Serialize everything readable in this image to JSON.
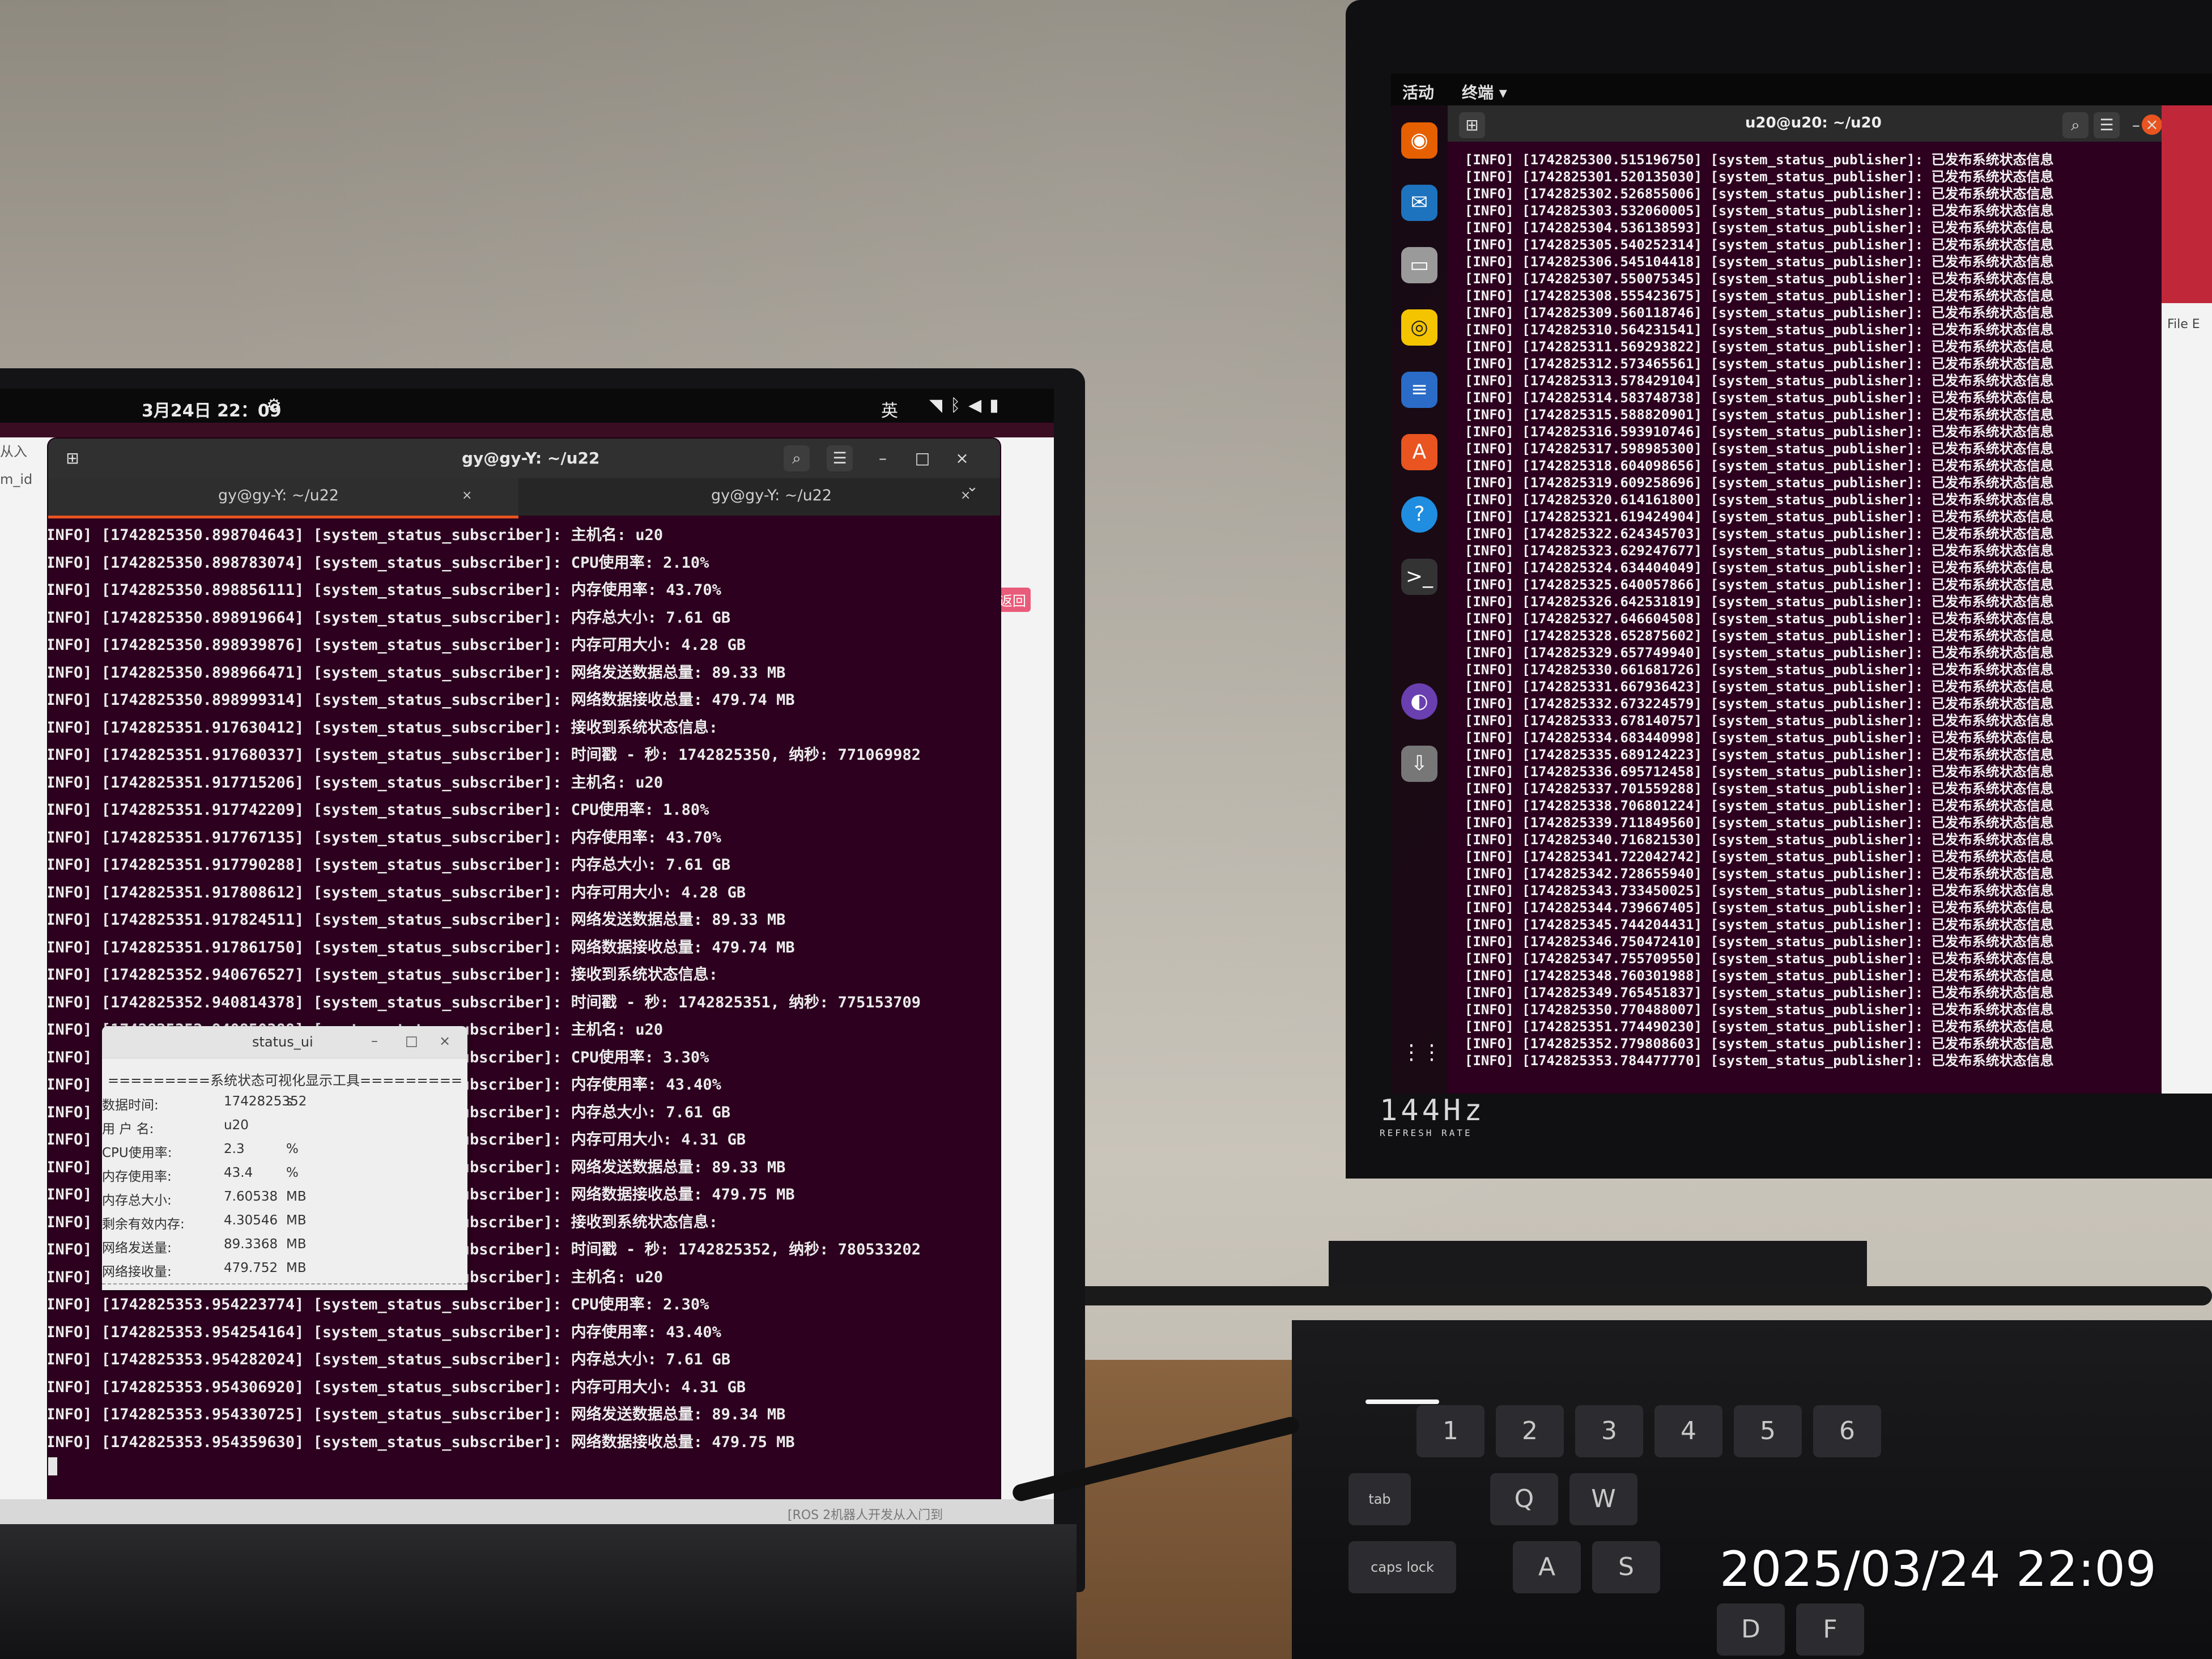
{
  "laptop": {
    "topbar": {
      "clock": "3月24日 22：09",
      "ime": "英"
    },
    "background_window": {
      "left_text_1": "从入",
      "left_text_2": "m_id",
      "badge": "返回"
    },
    "terminal": {
      "title": "gy@gy-Y: ~/u22",
      "tabs": [
        {
          "label": "gy@gy-Y: ~/u22"
        },
        {
          "label": "gy@gy-Y: ~/u22"
        }
      ],
      "lines": [
        "[INFO] [1742825350.898704643] [system_status_subscriber]: 主机名: u20",
        "[INFO] [1742825350.898783074] [system_status_subscriber]: CPU使用率: 2.10%",
        "[INFO] [1742825350.898856111] [system_status_subscriber]: 内存使用率: 43.70%",
        "[INFO] [1742825350.898919664] [system_status_subscriber]: 内存总大小: 7.61 GB",
        "[INFO] [1742825350.898939876] [system_status_subscriber]: 内存可用大小: 4.28 GB",
        "[INFO] [1742825350.898966471] [system_status_subscriber]: 网络发送数据总量: 89.33 MB",
        "[INFO] [1742825350.898999314] [system_status_subscriber]: 网络数据接收总量: 479.74 MB",
        "[INFO] [1742825351.917630412] [system_status_subscriber]: 接收到系统状态信息:",
        "[INFO] [1742825351.917680337] [system_status_subscriber]: 时间戳 - 秒: 1742825350, 纳秒: 771069982",
        "[INFO] [1742825351.917715206] [system_status_subscriber]: 主机名: u20",
        "[INFO] [1742825351.917742209] [system_status_subscriber]: CPU使用率: 1.80%",
        "[INFO] [1742825351.917767135] [system_status_subscriber]: 内存使用率: 43.70%",
        "[INFO] [1742825351.917790288] [system_status_subscriber]: 内存总大小: 7.61 GB",
        "[INFO] [1742825351.917808612] [system_status_subscriber]: 内存可用大小: 4.28 GB",
        "[INFO] [1742825351.917824511] [system_status_subscriber]: 网络发送数据总量: 89.33 MB",
        "[INFO] [1742825351.917861750] [system_status_subscriber]: 网络数据接收总量: 479.74 MB",
        "[INFO] [1742825352.940676527] [system_status_subscriber]: 接收到系统状态信息:",
        "[INFO] [1742825352.940814378] [system_status_subscriber]: 时间戳 - 秒: 1742825351, 纳秒: 775153709",
        "[INFO] [1742825352.940850388] [system_status_subscriber]: 主机名: u20",
        "[INFO] [1742825352.940888817] [system_status_subscriber]: CPU使用率: 3.30%",
        "[INFO] [1742825352.940924936] [system_status_subscriber]: 内存使用率: 43.40%",
        "[INFO] [1742825352.940958902] [system_status_subscriber]: 内存总大小: 7.61 GB",
        "[INFO] [1742825352.940989244] [system_status_subscriber]: 内存可用大小: 4.31 GB",
        "[INFO] [1742825352.941022103] [system_status_subscriber]: 网络发送数据总量: 89.33 MB",
        "[INFO] [1742825352.941057308] [system_status_subscriber]: 网络数据接收总量: 479.75 MB",
        "[INFO] [1742825353.954055702] [system_status_subscriber]: 接收到系统状态信息:",
        "[INFO] [1742825353.954167562] [system_status_subscriber]: 时间戳 - 秒: 1742825352, 纳秒: 780533202",
        "[INFO] [1742825353.954198097] [system_status_subscriber]: 主机名: u20",
        "[INFO] [1742825353.954223774] [system_status_subscriber]: CPU使用率: 2.30%",
        "[INFO] [1742825353.954254164] [system_status_subscriber]: 内存使用率: 43.40%",
        "[INFO] [1742825353.954282024] [system_status_subscriber]: 内存总大小: 7.61 GB",
        "[INFO] [1742825353.954306920] [system_status_subscriber]: 内存可用大小: 4.31 GB",
        "[INFO] [1742825353.954330725] [system_status_subscriber]: 网络发送数据总量: 89.34 MB",
        "[INFO] [1742825353.954359630] [system_status_subscriber]: 网络数据接收总量: 479.75 MB"
      ]
    },
    "status_window": {
      "title": "status_ui",
      "heading": "=========系统状态可视化显示工具=========",
      "rows": [
        {
          "label": "数据时间:",
          "value": "1742825352",
          "unit": "s"
        },
        {
          "label": "用 户 名:",
          "value": "u20",
          "unit": ""
        },
        {
          "label": "CPU使用率:",
          "value": "2.3",
          "unit": "%"
        },
        {
          "label": "内存使用率:",
          "value": "43.4",
          "unit": "%"
        },
        {
          "label": "内存总大小:",
          "value": "7.60538",
          "unit": "MB"
        },
        {
          "label": "剩余有效内存:",
          "value": "4.30546",
          "unit": "MB"
        },
        {
          "label": "网络发送量:",
          "value": "89.3368",
          "unit": "MB"
        },
        {
          "label": "网络接收量:",
          "value": "479.752",
          "unit": "MB"
        }
      ]
    },
    "bottom_strip": "[ROS 2机器人开发从入门到"
  },
  "monitor": {
    "topbar": {
      "activities": "活动",
      "app_menu": "终端 ▾"
    },
    "terminal_title": "u20@u20: ~/u20",
    "side_window_text": "File E",
    "log_prefix": "[INFO] [",
    "log_suffix": "] [system_status_publisher]: 已发布系统状态信息",
    "timestamps": [
      "1742825300.515196750",
      "1742825301.520135030",
      "1742825302.526855006",
      "1742825303.532060005",
      "1742825304.536138593",
      "1742825305.540252314",
      "1742825306.545104418",
      "1742825307.550075345",
      "1742825308.555423675",
      "1742825309.560118746",
      "1742825310.564231541",
      "1742825311.569293822",
      "1742825312.573465561",
      "1742825313.578429104",
      "1742825314.583748738",
      "1742825315.588820901",
      "1742825316.593910746",
      "1742825317.598985300",
      "1742825318.604098656",
      "1742825319.609258696",
      "1742825320.614161800",
      "1742825321.619424904",
      "1742825322.624345703",
      "1742825323.629247677",
      "1742825324.634404049",
      "1742825325.640057866",
      "1742825326.642531819",
      "1742825327.646604508",
      "1742825328.652875602",
      "1742825329.657749940",
      "1742825330.661681726",
      "1742825331.667936423",
      "1742825332.673224579",
      "1742825333.678140757",
      "1742825334.683440998",
      "1742825335.689124223",
      "1742825336.695712458",
      "1742825337.701559288",
      "1742825338.706801224",
      "1742825339.711849560",
      "1742825340.716821530",
      "1742825341.722042742",
      "1742825342.728655940",
      "1742825343.733450025",
      "1742825344.739667405",
      "1742825345.744204431",
      "1742825346.750472410",
      "1742825347.755709550",
      "1742825348.760301988",
      "1742825349.765451837",
      "1742825350.770488007",
      "1742825351.774490230",
      "1742825352.779808603",
      "1742825353.784477770"
    ],
    "refresh_hz": "144Hz",
    "refresh_rate": "REFRESH RATE"
  },
  "keyboard": {
    "keys": [
      "1",
      "2",
      "3",
      "4",
      "5",
      "6",
      "Q",
      "W",
      "A",
      "S",
      "D",
      "F",
      "tab",
      "caps lock"
    ]
  },
  "photo_timestamp": "2025/03/24 22:09"
}
